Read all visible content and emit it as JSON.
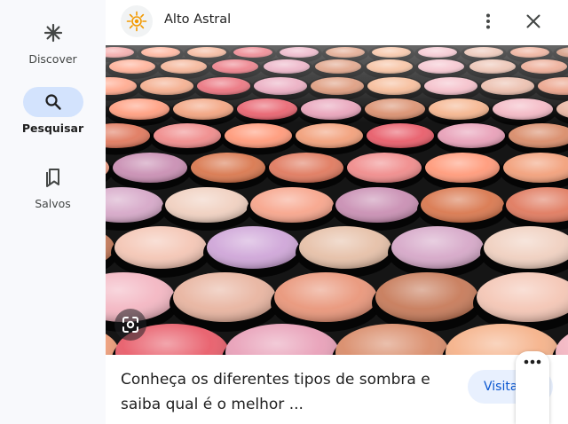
{
  "nav": {
    "items": [
      {
        "label": "Discover",
        "icon": "asterisk-icon",
        "active": false
      },
      {
        "label": "Pesquisar",
        "icon": "search-icon",
        "active": true
      },
      {
        "label": "Salvos",
        "icon": "bookmarks-icon",
        "active": false
      }
    ]
  },
  "result": {
    "site_name": "Alto Astral",
    "site_logo_icon": "sun-logo-icon",
    "image_alt": "Paleta de sombras",
    "caption": "Conheça os diferentes tipos de sombra e saiba qual é o melhor ...",
    "visit_label": "Visitar"
  },
  "colors": {
    "accent": "#0b57d0",
    "active_pill": "#d3e3fd",
    "rail_bg": "#f8f9fc",
    "logo_orange": "#f29900"
  }
}
